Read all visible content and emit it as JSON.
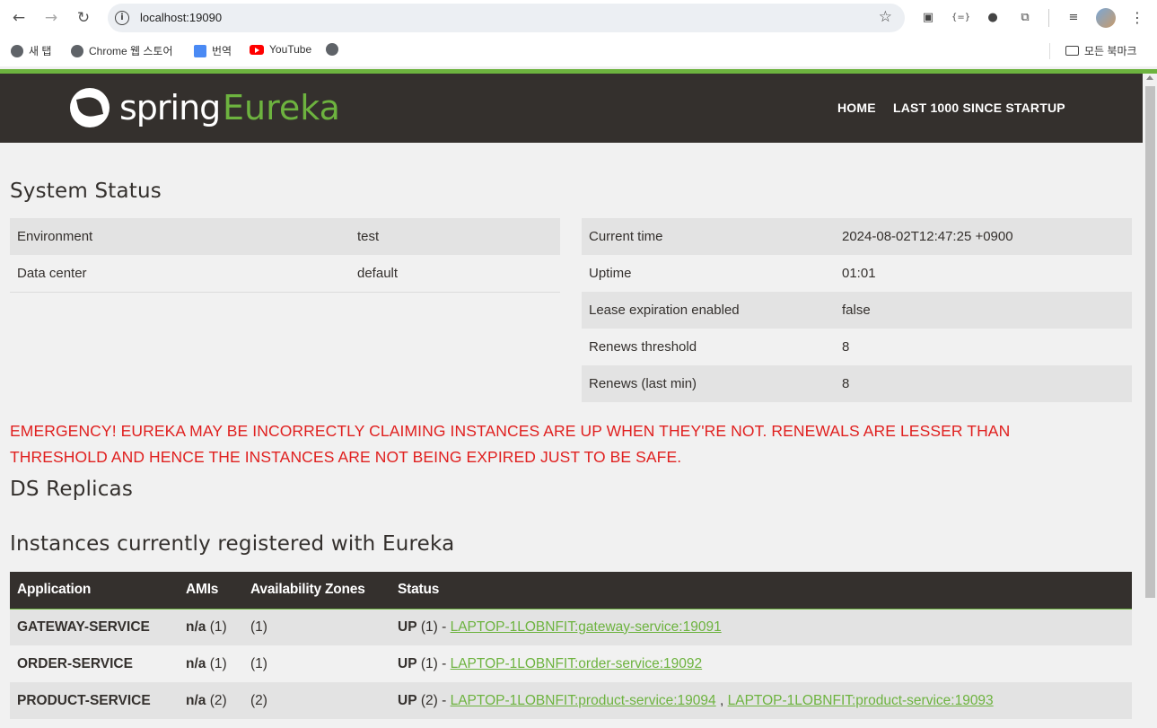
{
  "browser": {
    "url": "localhost:19090",
    "bookmarks": [
      "새 탭",
      "Chrome 웹 스토어",
      "번역",
      "YouTube"
    ],
    "all_bookmarks": "모든 북마크"
  },
  "header": {
    "logo_word1": "spring",
    "logo_word2": "Eureka",
    "nav": [
      "HOME",
      "LAST 1000 SINCE STARTUP"
    ]
  },
  "system_status": {
    "title": "System Status",
    "left": [
      {
        "label": "Environment",
        "value": "test"
      },
      {
        "label": "Data center",
        "value": "default"
      }
    ],
    "right": [
      {
        "label": "Current time",
        "value": "2024-08-02T12:47:25 +0900"
      },
      {
        "label": "Uptime",
        "value": "01:01"
      },
      {
        "label": "Lease expiration enabled",
        "value": "false"
      },
      {
        "label": "Renews threshold",
        "value": "8"
      },
      {
        "label": "Renews (last min)",
        "value": "8"
      }
    ]
  },
  "emergency": {
    "line1": "EMERGENCY! EUREKA MAY BE INCORRECTLY CLAIMING INSTANCES ARE UP WHEN THEY'RE NOT. RENEWALS ARE LESSER THAN",
    "line2": "THRESHOLD AND HENCE THE INSTANCES ARE NOT BEING EXPIRED JUST TO BE SAFE."
  },
  "ds_replicas": {
    "title": "DS Replicas"
  },
  "instances": {
    "title": "Instances currently registered with Eureka",
    "columns": [
      "Application",
      "AMIs",
      "Availability Zones",
      "Status"
    ],
    "rows": [
      {
        "app": "GATEWAY-SERVICE",
        "ami_label": "n/a",
        "ami_count": "(1)",
        "zones": "(1)",
        "status": "UP",
        "status_count": "(1) -",
        "links": [
          "LAPTOP-1LOBNFIT:gateway-service:19091"
        ]
      },
      {
        "app": "ORDER-SERVICE",
        "ami_label": "n/a",
        "ami_count": "(1)",
        "zones": "(1)",
        "status": "UP",
        "status_count": "(1) -",
        "links": [
          "LAPTOP-1LOBNFIT:order-service:19092"
        ]
      },
      {
        "app": "PRODUCT-SERVICE",
        "ami_label": "n/a",
        "ami_count": "(2)",
        "zones": "(2)",
        "status": "UP",
        "status_count": "(2) -",
        "links": [
          "LAPTOP-1LOBNFIT:product-service:19094",
          "LAPTOP-1LOBNFIT:product-service:19093"
        ]
      }
    ],
    "link_separator": ","
  },
  "colors": {
    "accent": "#6db33f",
    "header_bg": "#34302d",
    "emergency": "#e0201f"
  }
}
